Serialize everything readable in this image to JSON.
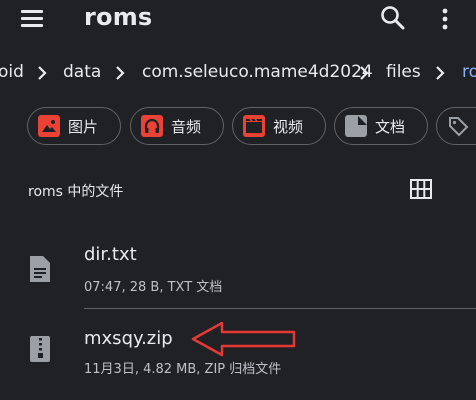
{
  "appbar": {
    "title": "roms",
    "menu_icon": "hamburger-menu-icon",
    "search_icon": "search-icon",
    "more_icon": "more-vert-icon"
  },
  "breadcrumbs": [
    "oid",
    "data",
    "com.seleuco.mame4d2024",
    "files",
    "ro"
  ],
  "chips": [
    {
      "label": "图片",
      "icon": "image-icon",
      "color": "#ea4335"
    },
    {
      "label": "音频",
      "icon": "headphones-icon",
      "color": "#ea4335"
    },
    {
      "label": "视频",
      "icon": "movie-icon",
      "color": "#ea4335"
    },
    {
      "label": "文档",
      "icon": "document-icon",
      "color": "#9aa0a6"
    },
    {
      "label": "",
      "icon": "label-tag-icon",
      "color": "#9aa0a6"
    }
  ],
  "section": {
    "title": "roms 中的文件",
    "view_toggle_icon": "grid-view-icon"
  },
  "files": [
    {
      "name": "dir.txt",
      "meta": "07:47, 28 B, TXT 文档",
      "icon": "text-file-icon"
    },
    {
      "name": "mxsqy.zip",
      "meta": "11月3日, 4.82 MB, ZIP 归档文件",
      "icon": "zip-file-icon"
    }
  ],
  "annotation": {
    "color": "#e53935"
  }
}
